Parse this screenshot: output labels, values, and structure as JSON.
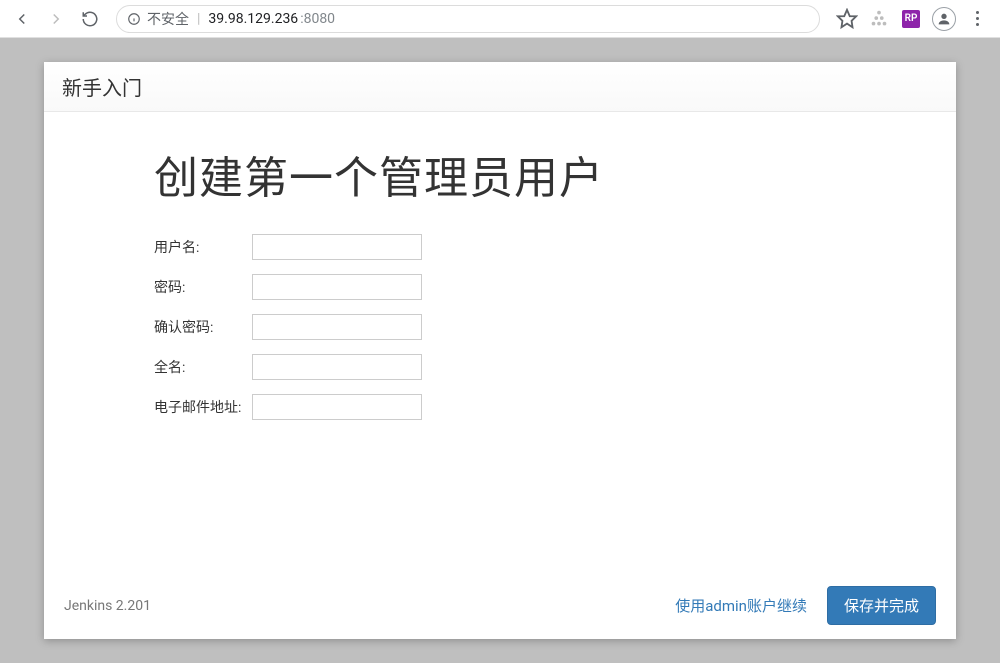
{
  "browser": {
    "security_label": "不安全",
    "host": "39.98.129.236",
    "port": ":8080",
    "ext_badge": "RP"
  },
  "wizard": {
    "breadcrumb": "新手入门",
    "title": "创建第一个管理员用户"
  },
  "form": {
    "username": {
      "label": "用户名:",
      "value": ""
    },
    "password": {
      "label": "密码:",
      "value": ""
    },
    "confirm": {
      "label": "确认密码:",
      "value": ""
    },
    "fullname": {
      "label": "全名:",
      "value": ""
    },
    "email": {
      "label": "电子邮件地址:",
      "value": ""
    }
  },
  "footer": {
    "version": "Jenkins 2.201",
    "skip_link": "使用admin账户继续",
    "save_button": "保存并完成"
  }
}
